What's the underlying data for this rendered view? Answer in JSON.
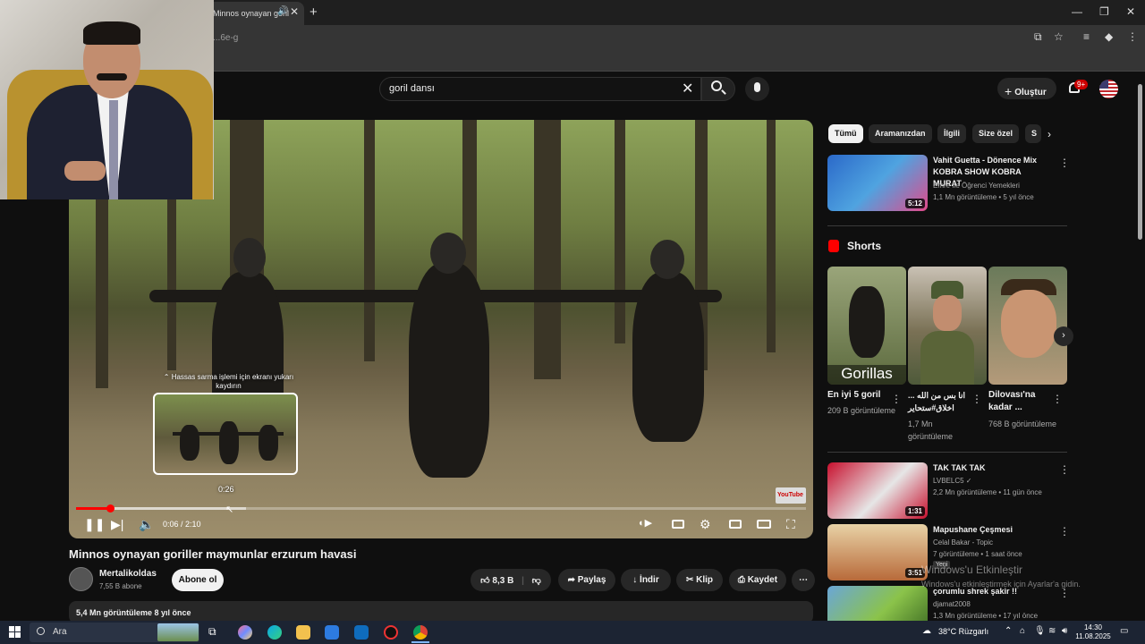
{
  "browser": {
    "tab_title": "Minnos oynayan goril",
    "url": "...6e-g",
    "new_tab": "+",
    "window_minimize": "—",
    "window_restore": "❐",
    "window_close": "✕"
  },
  "header": {
    "search_value": "goril dansı",
    "create_label": "Oluştur",
    "notification_count": "9+"
  },
  "player": {
    "hint": "⌃ Hassas sarma işlemi için ekranı yukarı kaydırın",
    "preview_time": "0:26",
    "current_time": "0:06 / 2:10",
    "progress_fraction": 0.046,
    "watermark": "YouTube"
  },
  "video": {
    "title": "Minnos oynayan goriller maymunlar erzurum havasi",
    "channel_name": "Mertalikoldas",
    "subscribers": "7,55 B abone",
    "subscribe_label": "Abone ol",
    "like_count": "8,3 B",
    "share_label": "Paylaş",
    "download_label": "İndir",
    "clip_label": "Klip",
    "save_label": "Kaydet",
    "views_date": "5,4 Mn görüntüleme  8 yıl önce"
  },
  "sidebar": {
    "chips": [
      "Tümü",
      "Aramanızdan",
      "İlgili",
      "Size özel",
      "S"
    ],
    "recs": [
      {
        "title": "Vahit Guetta - Dönence Mix KOBRA SHOW KOBRA MURAT",
        "channel": "Emre İle Öğrenci Yemekleri",
        "meta": "1,1 Mn görüntüleme • 5 yıl önce",
        "duration": "5:12"
      },
      {
        "title": "TAK TAK TAK",
        "channel": "LVBELC5 ✓",
        "meta": "2,2 Mn görüntüleme • 11 gün önce",
        "duration": "1:31"
      },
      {
        "title": "Mapushane Çeşmesi",
        "channel": "Celal Bakar - Topic",
        "meta": "7 görüntüleme • 1 saat önce",
        "duration": "3:51",
        "badge": "Yeni"
      },
      {
        "title": "çorumlu shrek şakir !!",
        "channel": "djamat2008",
        "meta": "1,3 Mn görüntüleme • 17 yıl önce",
        "duration": ""
      }
    ],
    "shorts_heading": "Shorts",
    "shorts": [
      {
        "title": "En iyi 5 goril",
        "meta": "209 B görüntüleme",
        "thumb_text": "Gorillas"
      },
      {
        "title": "انا بس من الله ... اخلاق#ستحایر",
        "meta": "1,7 Mn görüntüleme",
        "thumb_text": ""
      },
      {
        "title": "Dilovası'na kadar ...",
        "meta": "768 B görüntüleme",
        "thumb_text": ""
      }
    ]
  },
  "windows": {
    "activate_title": "Windows'u Etkinleştir",
    "activate_sub": "Windows'u etkinleştirmek için Ayarlar'a gidin."
  },
  "taskbar": {
    "search_label": "Ara",
    "weather": "38°C  Rüzgarlı",
    "time": "14:30",
    "date": "11.08.2025"
  }
}
